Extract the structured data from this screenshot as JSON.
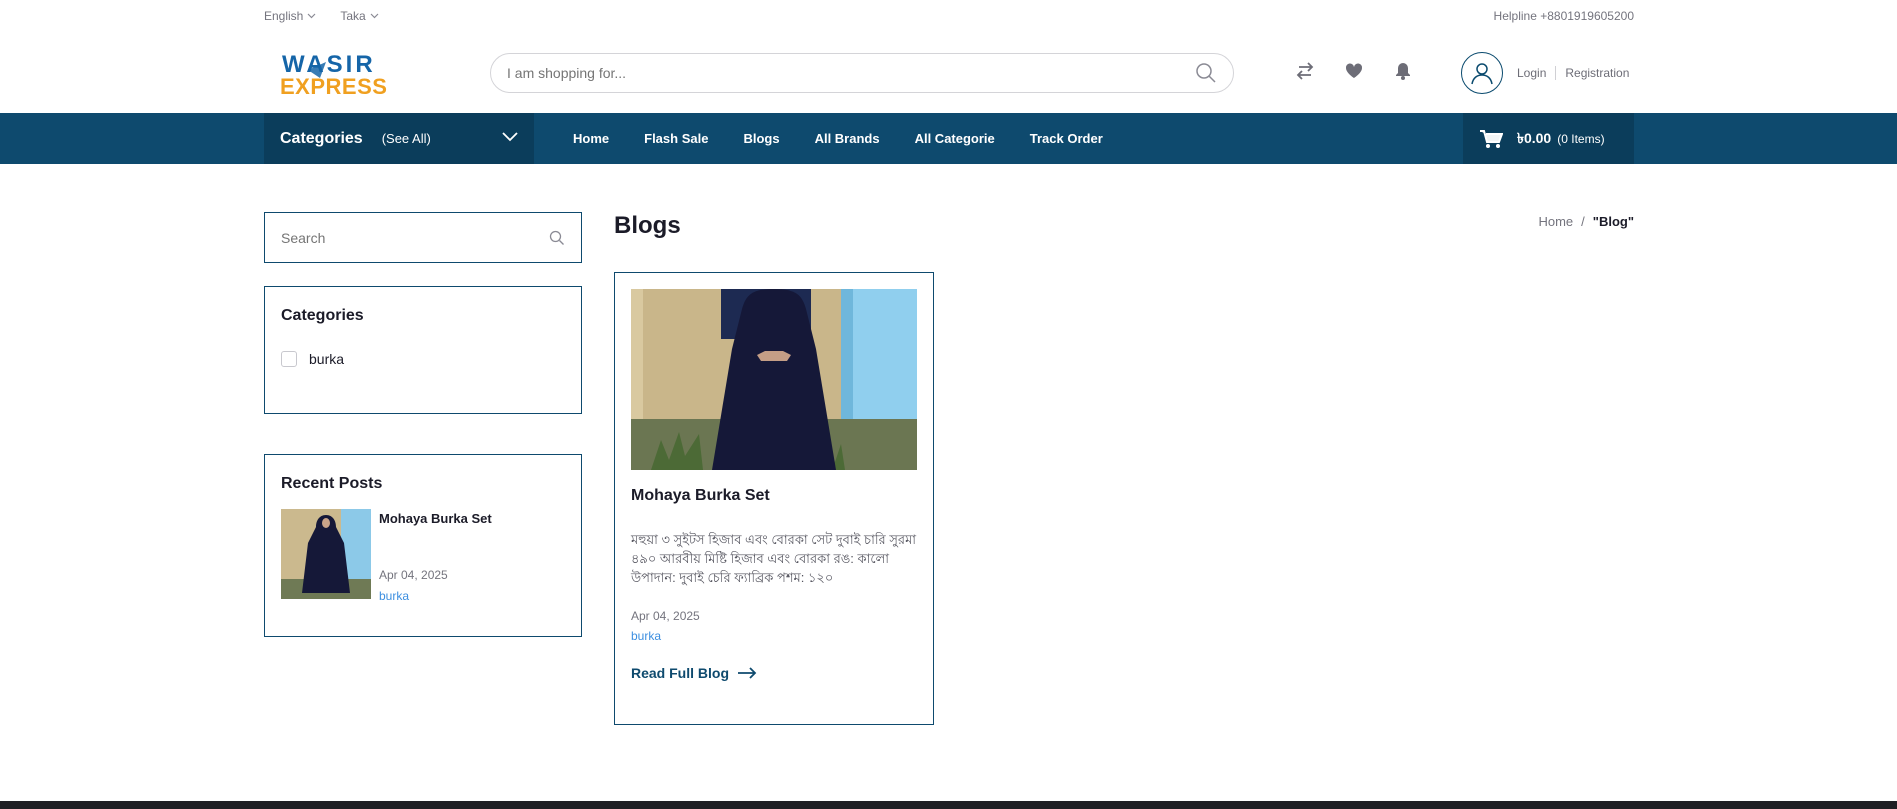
{
  "topbar": {
    "language": "English",
    "currency": "Taka",
    "helpline": "Helpline +8801919605200"
  },
  "logo": {
    "line1": "WASIR",
    "line2": "EXPRESS"
  },
  "header": {
    "search_placeholder": "I am shopping for...",
    "login": "Login",
    "registration": "Registration"
  },
  "nav": {
    "categories_title": "Categories",
    "categories_see_all": "(See All)",
    "links": [
      "Home",
      "Flash Sale",
      "Blogs",
      "All Brands",
      "All Categorie",
      "Track Order"
    ],
    "cart_amount": "৳0.00",
    "cart_items": "(0 Items)"
  },
  "sidebar": {
    "search_placeholder": "Search",
    "categories_title": "Categories",
    "categories": [
      "burka"
    ],
    "recent_title": "Recent Posts",
    "recent": [
      {
        "title": "Mohaya Burka Set",
        "date": "Apr 04, 2025",
        "category": "burka"
      }
    ]
  },
  "main": {
    "page_title": "Blogs",
    "breadcrumb": [
      "Home",
      "/",
      "\"Blog\""
    ],
    "posts": [
      {
        "title": "Mohaya Burka Set",
        "excerpt": "মহুয়া ৩ সুইটস হিজাব এবং বোরকা সেট দুবাই চারি সুরমা ৪৯০ আরবীয় মিষ্টি হিজাব এবং বোরকা রঙ: কালো উপাদান: দুবাই চেরি ফ্যাব্রিক পশম: ১২০",
        "date": "Apr 04, 2025",
        "category": "burka",
        "read_more": "Read Full Blog"
      }
    ]
  },
  "colors": {
    "primary": "#0e4a6e",
    "primary_dark": "#0b3d5b",
    "link": "#3d8fe0",
    "logo_blue": "#1565a8",
    "logo_orange": "#f0a020"
  }
}
